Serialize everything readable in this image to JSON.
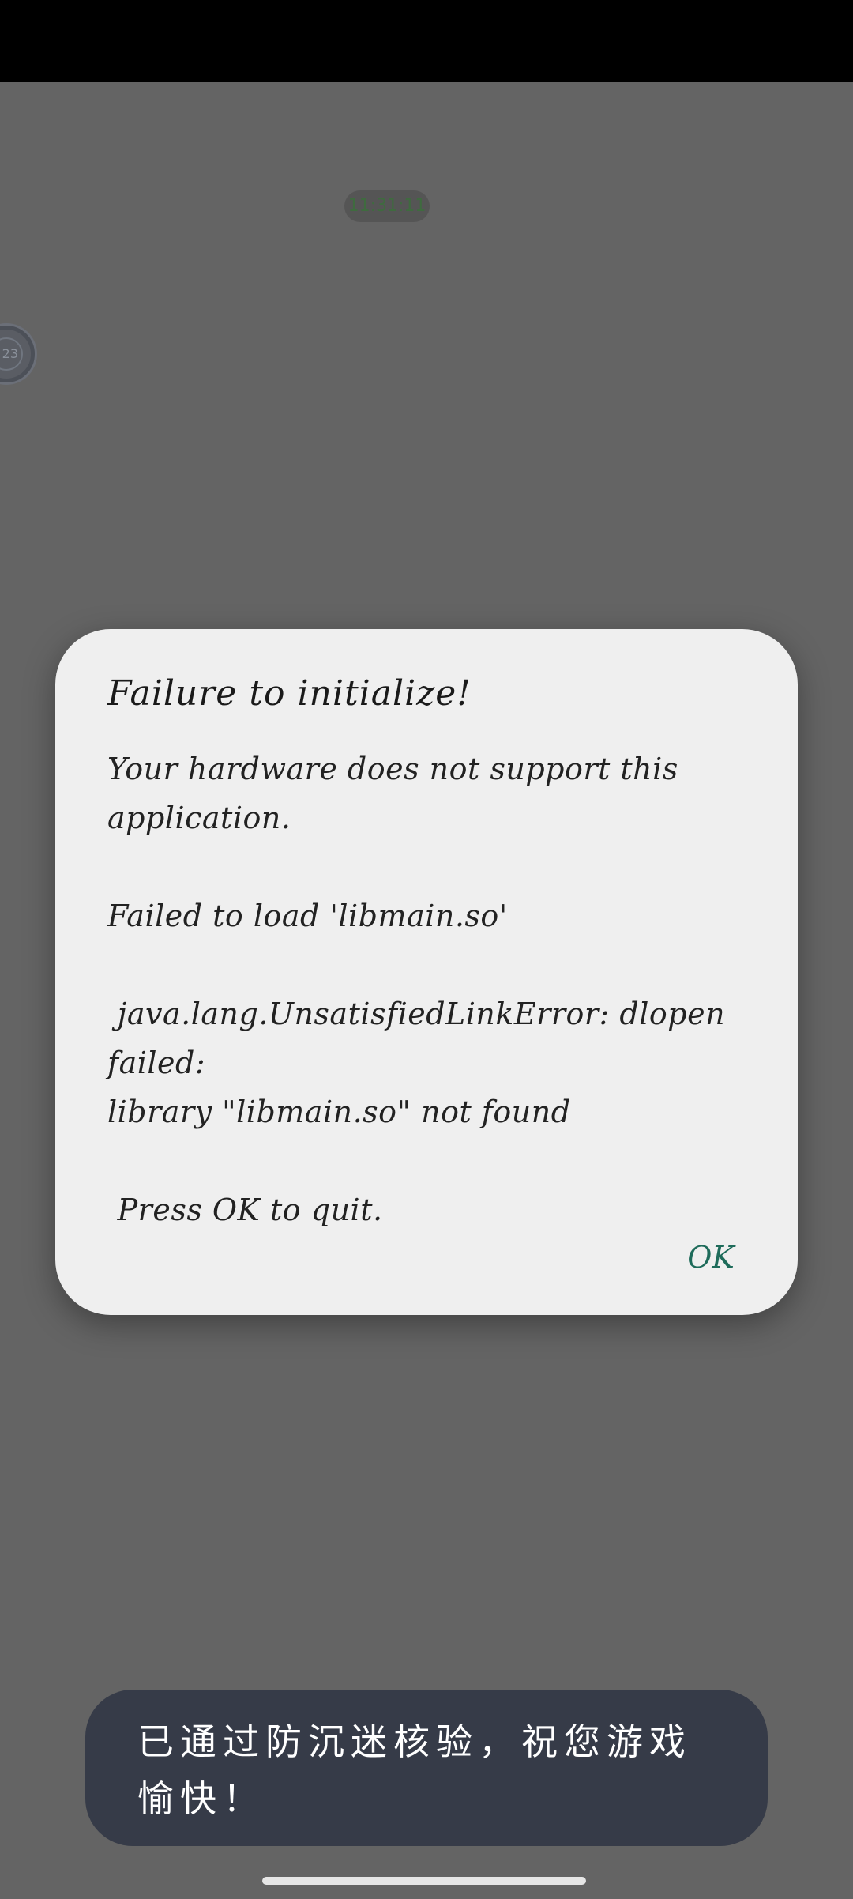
{
  "pill": {
    "label": "11:31:11"
  },
  "float_badge": {
    "label": "23"
  },
  "dialog": {
    "title": "Failure to initialize!",
    "message": "Your hardware does not support this\napplication.\n\nFailed to load 'libmain.so'\n\n java.lang.UnsatisfiedLinkError: dlopen failed:\nlibrary \"libmain.so\" not found\n\n Press OK to quit.",
    "ok_label": "OK"
  },
  "toast": {
    "text": "已通过防沉迷核验，祝您游戏愉快！"
  },
  "colors": {
    "background_dim": "#646464",
    "dialog_bg": "#efefef",
    "ok_accent": "#1e6b5a",
    "toast_bg": "#363b48"
  }
}
